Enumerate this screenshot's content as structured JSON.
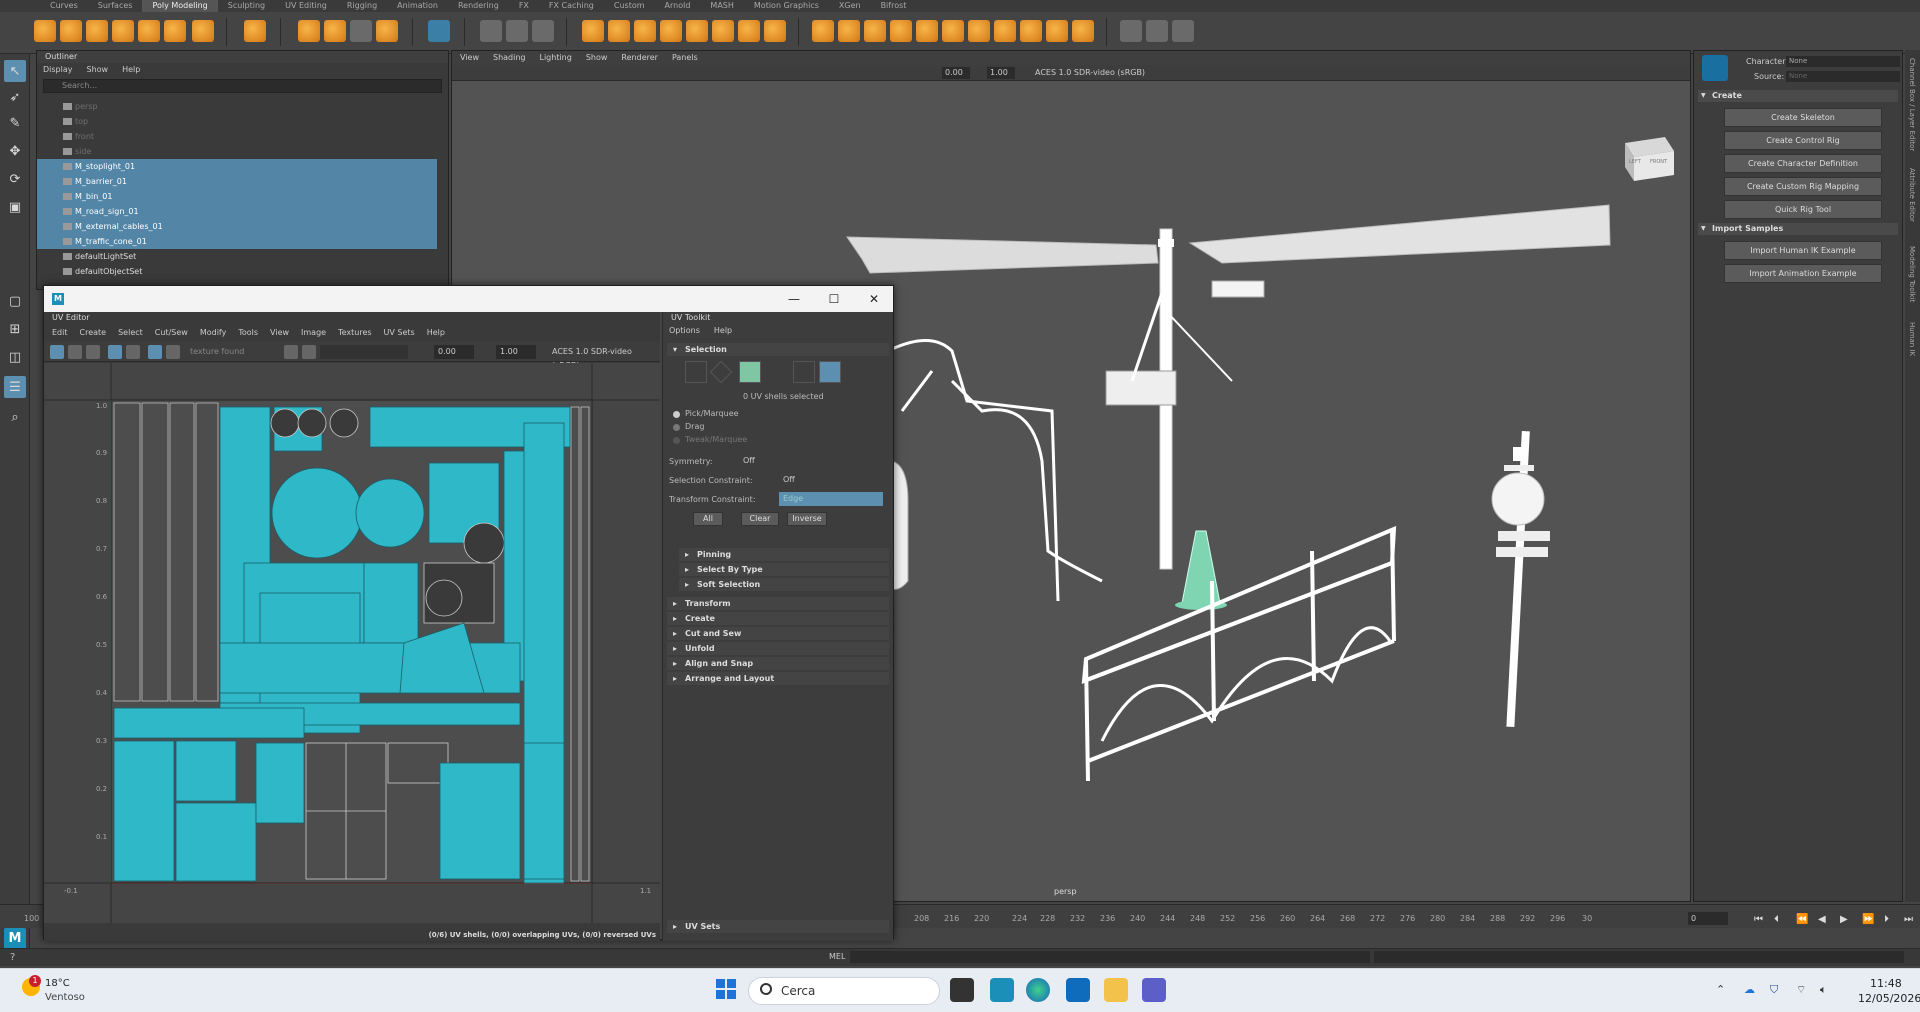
{
  "shelf": {
    "tabs": [
      "Curves",
      "Surfaces",
      "Poly Modeling",
      "Sculpting",
      "UV Editing",
      "Rigging",
      "Animation",
      "Rendering",
      "FX",
      "FX Caching",
      "Custom",
      "Arnold",
      "MASH",
      "Motion Graphics",
      "XGen",
      "Bifrost"
    ],
    "active_tab": "Poly Modeling"
  },
  "outliner": {
    "title": "Outliner",
    "menu": [
      "Display",
      "Show",
      "Help"
    ],
    "search_placeholder": "Search...",
    "rows": [
      {
        "label": "persp",
        "state": "dim"
      },
      {
        "label": "top",
        "state": "dim"
      },
      {
        "label": "front",
        "state": "dim"
      },
      {
        "label": "side",
        "state": "dim"
      },
      {
        "label": "M_stoplight_01",
        "state": "sel"
      },
      {
        "label": "M_barrier_01",
        "state": "sel"
      },
      {
        "label": "M_bin_01",
        "state": "sel"
      },
      {
        "label": "M_road_sign_01",
        "state": "sel"
      },
      {
        "label": "M_external_cables_01",
        "state": "sel"
      },
      {
        "label": "M_traffic_cone_01",
        "state": "sel"
      },
      {
        "label": "defaultLightSet",
        "state": "normal"
      },
      {
        "label": "defaultObjectSet",
        "state": "normal"
      }
    ]
  },
  "viewport": {
    "menu": [
      "View",
      "Shading",
      "Lighting",
      "Show",
      "Renderer",
      "Panels"
    ],
    "field_a": "0.00",
    "field_b": "1.00",
    "colorspace": "ACES 1.0 SDR-video (sRGB)",
    "camera_label": "persp",
    "viewcube_left": "LEFT",
    "viewcube_front": "FRONT"
  },
  "rig": {
    "character_label": "Character:",
    "character_value": "None",
    "source_label": "Source:",
    "source_value": "None",
    "create_section": "Create",
    "create_buttons": [
      "Create Skeleton",
      "Create Control Rig",
      "Create Character Definition",
      "Create Custom Rig Mapping",
      "Quick Rig Tool"
    ],
    "import_section": "Import Samples",
    "import_buttons": [
      "Import Human IK Example",
      "Import Animation Example"
    ],
    "side_tabs": [
      "Channel Box / Layer Editor",
      "Attribute Editor",
      "Modeling Toolkit",
      "Human IK"
    ]
  },
  "uv_editor": {
    "window_title": "UV Editor",
    "menu": [
      "Edit",
      "Create",
      "Select",
      "Cut/Sew",
      "Modify",
      "Tools",
      "View",
      "Image",
      "Textures",
      "UV Sets",
      "Help"
    ],
    "texture_field": "texture found",
    "field_a": "0.00",
    "field_b": "1.00",
    "colorspace": "ACES 1.0 SDR-video (sRGB)",
    "status": "(0/6) UV shells, (0/0) overlapping UVs, (0/0) reversed UVs",
    "axis_labels": [
      "1.0",
      "0.9",
      "0.8",
      "0.7",
      "0.6",
      "0.5",
      "0.4",
      "0.3",
      "0.2",
      "0.1"
    ],
    "corner_left": "-0.1",
    "corner_right": "1.1"
  },
  "uv_toolkit": {
    "title": "UV Toolkit",
    "menu": [
      "Options",
      "Help"
    ],
    "selection_section": "Selection",
    "shells_selected": "0 UV shells selected",
    "radio_options": [
      "Pick/Marquee",
      "Drag",
      "Tweak/Marquee"
    ],
    "symmetry_label": "Symmetry:",
    "symmetry_value": "Off",
    "sel_constraint_label": "Selection Constraint:",
    "sel_constraint_value": "Off",
    "transform_constraint_label": "Transform Constraint:",
    "transform_constraint_value": "Edge",
    "btn_all": "All",
    "btn_clear": "Clear",
    "btn_inverse": "Inverse",
    "sub_sections": [
      "Pinning",
      "Select By Type",
      "Soft Selection"
    ],
    "sections": [
      "Transform",
      "Create",
      "Cut and Sew",
      "Unfold",
      "Align and Snap",
      "Arrange and Layout"
    ],
    "uv_sets": "UV Sets"
  },
  "timeslider": {
    "ticks": [
      "208",
      "216",
      "220",
      "224",
      "228",
      "232",
      "236",
      "240",
      "244",
      "248",
      "252",
      "256",
      "260",
      "264",
      "268",
      "272",
      "276",
      "280",
      "284",
      "288",
      "292",
      "296",
      "30"
    ],
    "start": "100",
    "current": "0"
  },
  "cmdline": {
    "label": "MEL"
  },
  "taskbar": {
    "weather_badge": "1",
    "temperature": "18°C",
    "weather": "Ventoso",
    "search": "Cerca",
    "time": "11:48",
    "date": "12/05/2026"
  },
  "colors": {
    "accent": "#5285a6",
    "uv_cyan": "#2fb8c8",
    "maya_blue": "#1c8fb9"
  }
}
